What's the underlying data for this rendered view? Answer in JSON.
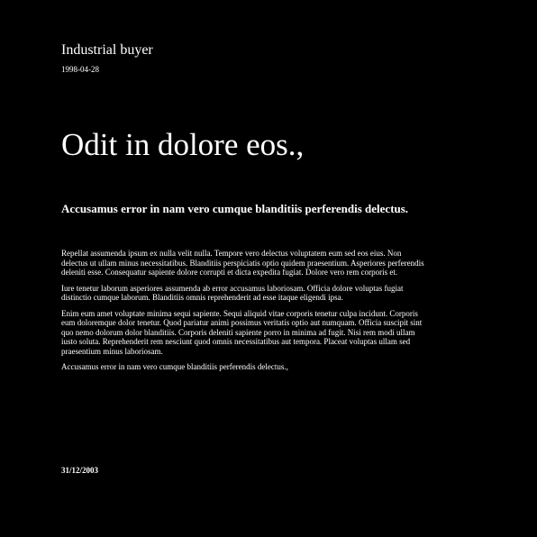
{
  "header": {
    "org": "Industrial buyer",
    "date": "1998-04-28"
  },
  "title": "Odit in dolore eos.,",
  "subtitle": "Accusamus error in nam vero cumque blanditiis perferendis delectus.",
  "paragraphs": [
    "Repellat assumenda ipsum ex nulla velit nulla. Tempore vero delectus voluptatem eum sed eos eius. Non delectus ut ullam minus necessitatibus. Blanditiis perspiciatis optio quidem praesentium. Asperiores perferendis deleniti esse. Consequatur sapiente dolore corrupti et dicta expedita fugiat. Dolore vero rem corporis et.",
    "Iure tenetur laborum asperiores assumenda ab error accusamus laboriosam. Officia dolore voluptas fugiat distinctio cumque laborum. Blanditiis omnis reprehenderit ad esse itaque eligendi ipsa.",
    "Enim eum amet voluptate minima sequi sapiente. Sequi aliquid vitae corporis tenetur culpa incidunt. Corporis eum doloremque dolor tenetur. Quod pariatur animi possimus veritatis optio aut numquam. Officia suscipit sint quo nemo dolorum dolor blanditiis. Corporis deleniti sapiente porro in minima ad fugit. Nisi rem modi ullam iusto soluta. Reprehenderit rem nesciunt quod omnis necessitatibus aut tempora. Placeat voluptas ullam sed praesentium minus laboriosam.",
    "Accusamus error in nam vero cumque blanditiis perferendis delectus.,"
  ],
  "footer": {
    "date": "31/12/2003"
  }
}
